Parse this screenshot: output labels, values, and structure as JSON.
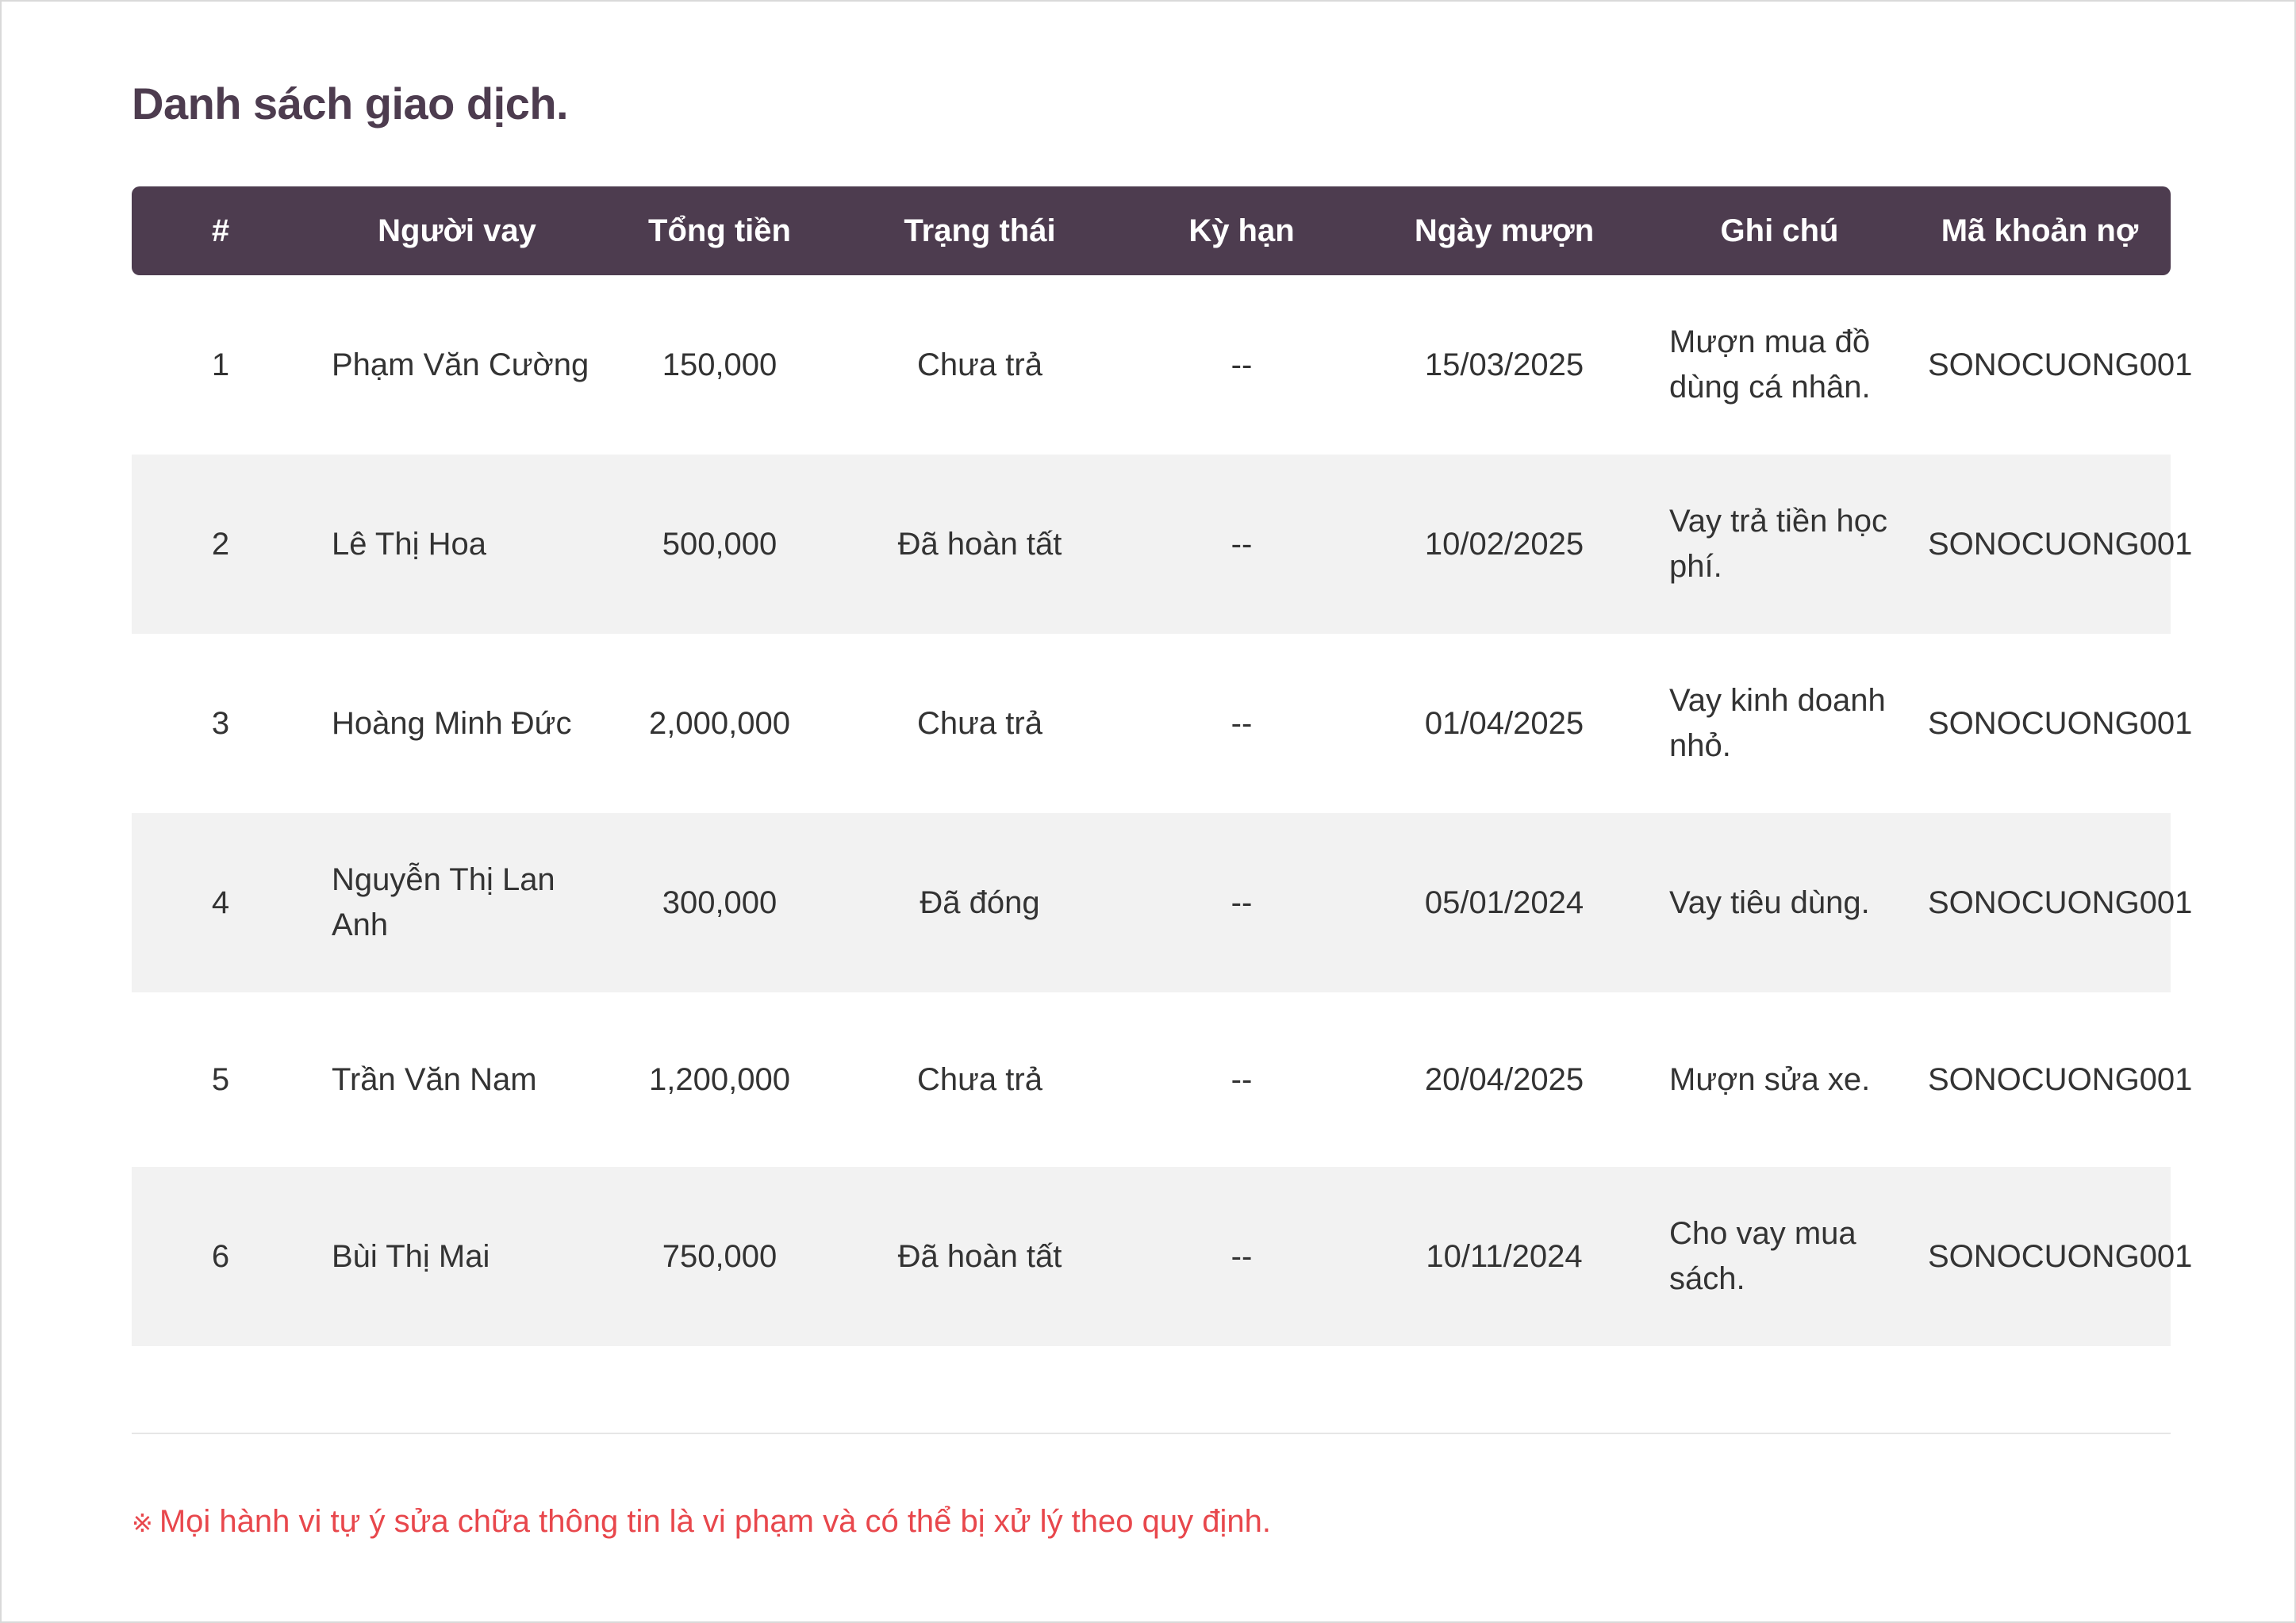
{
  "page": {
    "title": "Danh sách giao dịch."
  },
  "table": {
    "headers": [
      "#",
      "Người vay",
      "Tổng tiền",
      "Trạng thái",
      "Kỳ hạn",
      "Ngày mượn",
      "Ghi chú",
      "Mã khoản nợ"
    ],
    "rows": [
      {
        "num": "1",
        "borrower": "Phạm Văn Cường",
        "amount": "150,000",
        "status": "Chưa trả",
        "term": "--",
        "date": "15/03/2025",
        "note": "Mượn mua đồ dùng cá nhân.",
        "code": "SONOCUONG001"
      },
      {
        "num": "2",
        "borrower": "Lê Thị Hoa",
        "amount": "500,000",
        "status": "Đã hoàn tất",
        "term": "--",
        "date": "10/02/2025",
        "note": "Vay trả tiền học phí.",
        "code": "SONOCUONG001"
      },
      {
        "num": "3",
        "borrower": "Hoàng Minh Đức",
        "amount": "2,000,000",
        "status": "Chưa trả",
        "term": "--",
        "date": "01/04/2025",
        "note": "Vay kinh doanh nhỏ.",
        "code": "SONOCUONG001"
      },
      {
        "num": "4",
        "borrower": "Nguyễn Thị Lan Anh",
        "amount": "300,000",
        "status": "Đã đóng",
        "term": "--",
        "date": "05/01/2024",
        "note": "Vay tiêu dùng.",
        "code": "SONOCUONG001"
      },
      {
        "num": "5",
        "borrower": "Trần Văn Nam",
        "amount": "1,200,000",
        "status": "Chưa trả",
        "term": "--",
        "date": "20/04/2025",
        "note": "Mượn sửa xe.",
        "code": "SONOCUONG001"
      },
      {
        "num": "6",
        "borrower": "Bùi Thị Mai",
        "amount": "750,000",
        "status": "Đã hoàn tất",
        "term": "--",
        "date": "10/11/2024",
        "note": "Cho vay mua sách.",
        "code": "SONOCUONG001"
      }
    ]
  },
  "footer": {
    "notice_mark": "※",
    "notice": "Mọi hành vi tự ý sửa chữa thông tin là vi phạm và có thể bị xử lý theo quy định."
  },
  "colors": {
    "header_bg": "#4d3c4f",
    "title": "#4d3c4f",
    "stripe": "#f2f2f2",
    "warning": "#e8474c"
  }
}
